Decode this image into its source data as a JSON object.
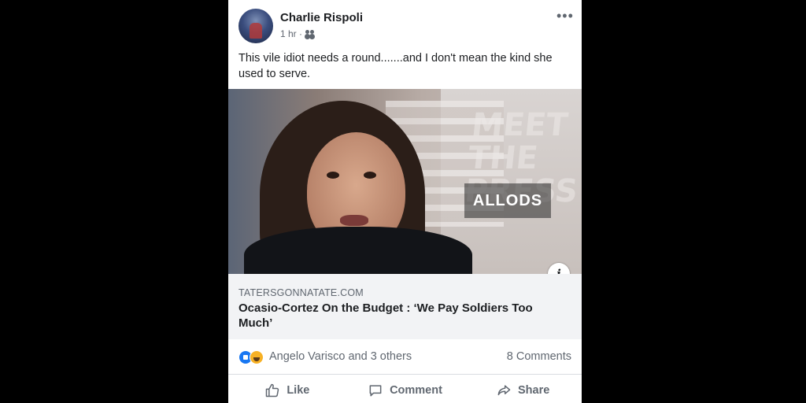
{
  "post": {
    "author": "Charlie Rispoli",
    "time": "1 hr ·",
    "audience_icon": "friends-icon",
    "more_icon": "•••",
    "text": "This vile idiot needs a round.......and I don't mean the kind she used to serve."
  },
  "link_preview": {
    "image_watermark": "MEET THE PRESS",
    "image_logo": "ALLODS",
    "info_icon": "i",
    "domain": "TATERSGONNATATE.COM",
    "title": "Ocasio-Cortez On the Budget : ‘We Pay Soldiers Too Much’"
  },
  "reactions": {
    "icons": [
      "like-reaction-icon",
      "haha-reaction-icon"
    ],
    "reactors": "Angelo Varisco and 3 others",
    "comments": "8 Comments"
  },
  "actions": {
    "like_label": "Like",
    "comment_label": "Comment",
    "share_label": "Share"
  },
  "colors": {
    "background": "#000000",
    "card": "#ffffff",
    "caption_bg": "#f2f3f5",
    "secondary_text": "#606770",
    "primary_text": "#1c1e21",
    "like_blue": "#1877f2"
  }
}
